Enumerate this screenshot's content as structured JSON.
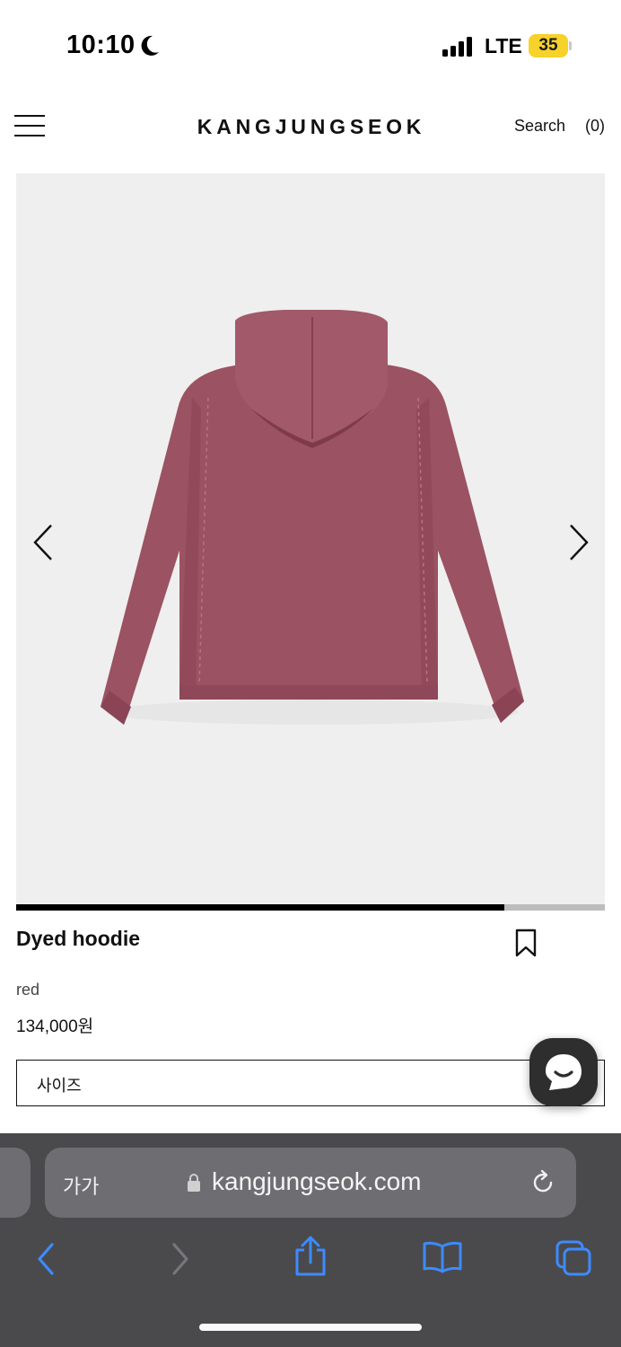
{
  "status_bar": {
    "time": "10:10",
    "network": "LTE",
    "battery": "35",
    "icons": [
      "moon-icon",
      "signal-icon",
      "battery-icon"
    ]
  },
  "header": {
    "brand": "KANGJUNGSEOK",
    "search_label": "Search",
    "cart_label": "(0)",
    "icons": [
      "hamburger-menu-icon"
    ]
  },
  "gallery": {
    "image_subject": "red dyed hoodie back view",
    "progress": 0.83,
    "icons": [
      "chevron-left-icon",
      "chevron-right-icon"
    ]
  },
  "product": {
    "name": "Dyed hoodie",
    "color": "red",
    "price": "134,000원",
    "size_label": "사이즈",
    "icons": [
      "bookmark-icon",
      "chat-icon"
    ]
  },
  "browser": {
    "text_size_label": "가가",
    "url": "kangjungseok.com",
    "icons": [
      "lock-icon",
      "reload-icon",
      "back-icon",
      "forward-icon",
      "share-icon",
      "bookmarks-icon",
      "tabs-icon"
    ]
  },
  "colors": {
    "accent_blue": "#3d8bff",
    "hoodie": "#9b5262",
    "battery": "#f6d22a",
    "chrome": "#4a4a4c"
  }
}
